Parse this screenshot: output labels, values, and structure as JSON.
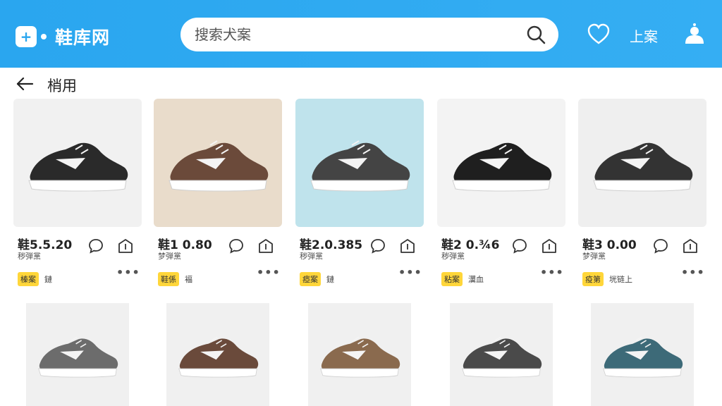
{
  "header": {
    "logo_mark": "+",
    "app_name": "鞋库网",
    "search_placeholder": "搜索犬案",
    "login_label": "上案"
  },
  "subheader": {
    "title": "梢用"
  },
  "products_row1": [
    {
      "price": "鞋5.5.20",
      "subtitle": "秽弾黨",
      "tag": "榛案",
      "tag_note": "鏈",
      "accent": "#2a2a2a",
      "bg": "#f1f1f1"
    },
    {
      "price": "鞋1 0.80",
      "subtitle": "梦弾黨",
      "tag": "鞋係",
      "tag_note": "褔",
      "accent": "#6b4a3a",
      "bg": "#e9dccb"
    },
    {
      "price": "鞋2.0.385",
      "subtitle": "秽弾黨",
      "tag": "瘂案",
      "tag_note": "鏈",
      "accent": "#444444",
      "bg": "#bfe3ec"
    },
    {
      "price": "鞋2 0.¾6",
      "subtitle": "秽弾黨",
      "tag": "粘案",
      "tag_note": "瀷血",
      "accent": "#1f1f1f",
      "bg": "#f3f3f3"
    },
    {
      "price": "鞋3 0.00",
      "subtitle": "梦弾黨",
      "tag": "疫第",
      "tag_note": "垙链上",
      "accent": "#333333",
      "bg": "#efefef"
    }
  ],
  "products_row2": [
    {
      "accent": "#6c6c6c",
      "bg": "#f0f0f0"
    },
    {
      "accent": "#6a4a3b",
      "bg": "#f0f0f0"
    },
    {
      "accent": "#8a6a4e",
      "bg": "#f0f0f0"
    },
    {
      "accent": "#4a4a4a",
      "bg": "#f0f0f0"
    },
    {
      "accent": "#3d6a78",
      "bg": "#f0f0f0"
    }
  ]
}
